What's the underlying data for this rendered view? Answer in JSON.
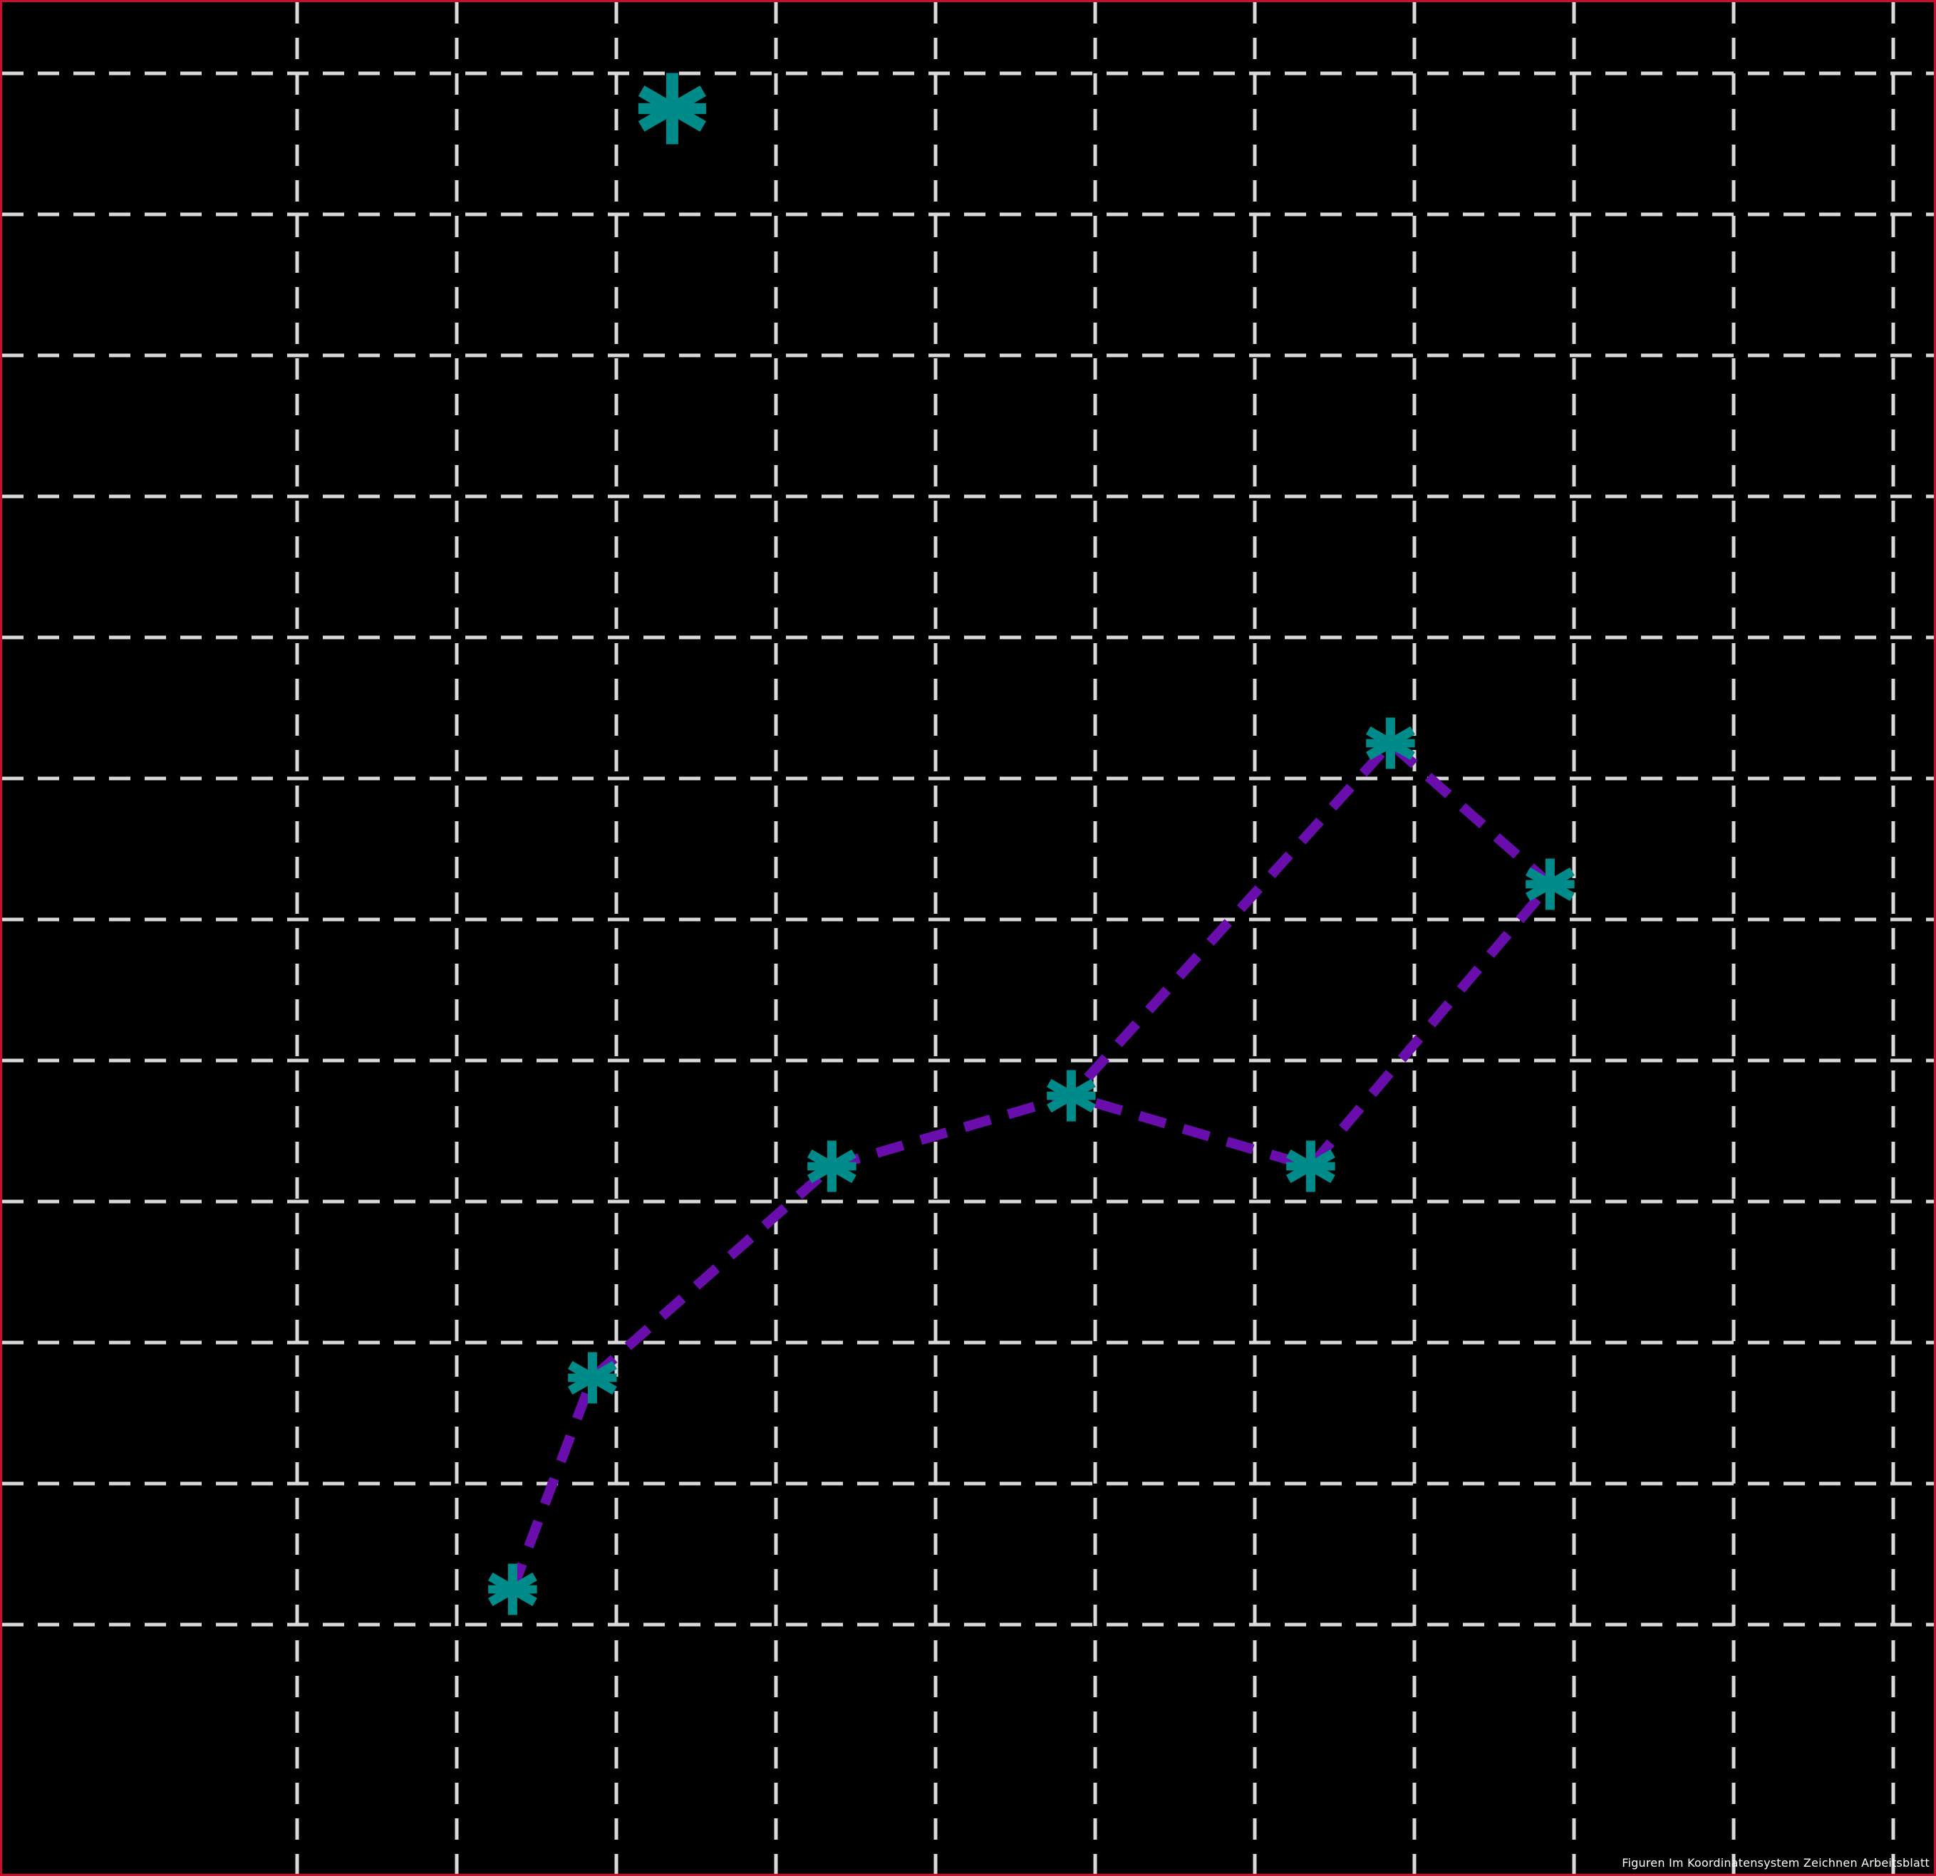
{
  "chart_data": {
    "type": "line",
    "title": "",
    "xlabel": "",
    "ylabel": "",
    "grid": true,
    "xlim": [
      0,
      12
    ],
    "ylim": [
      0,
      13
    ],
    "series": [
      {
        "values": [
          [
            2.35,
            1.25
          ],
          [
            2.85,
            2.75
          ],
          [
            4.35,
            4.25
          ],
          [
            5.85,
            4.75
          ],
          [
            7.35,
            4.25
          ],
          [
            8.85,
            6.25
          ],
          [
            7.85,
            7.25
          ],
          [
            5.85,
            4.75
          ]
        ]
      }
    ],
    "isolated_points": [
      [
        3.35,
        11.75
      ]
    ],
    "colors": {
      "background": "#000000",
      "grid": "#d9d9d9",
      "line": "#6a0dad",
      "marker": "#008b8b",
      "border": "#c8102e"
    }
  },
  "footer_text": "Figuren Im Koordinatensystem Zeichnen Arbeitsblatt"
}
